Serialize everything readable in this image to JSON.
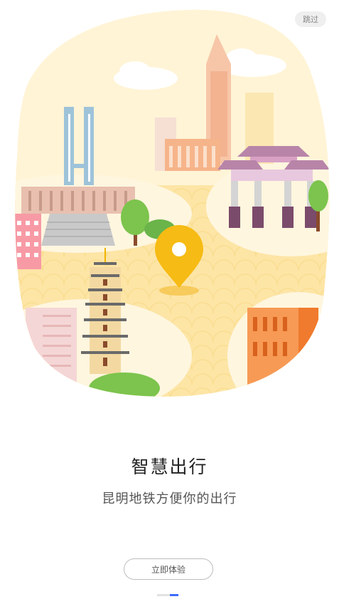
{
  "header": {
    "skip_label": "跳过"
  },
  "illustration": {
    "location_pin": "location-pin-icon"
  },
  "onboarding": {
    "title": "智慧出行",
    "subtitle": "昆明地铁方便你的出行",
    "cta_label": "立即体验",
    "page_index": 2,
    "page_count": 2
  },
  "colors": {
    "accent": "#3f6cff",
    "pin": "#f6bb14",
    "sand": "#fde9b6"
  }
}
